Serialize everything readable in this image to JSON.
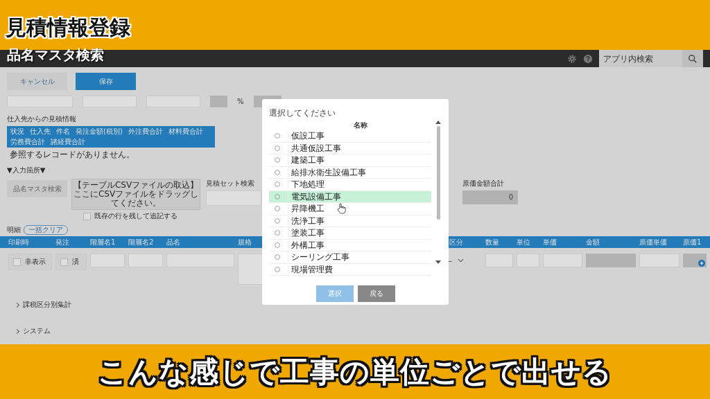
{
  "video_title": "見積情報登録",
  "video_subtitle": "品名マスタ検索",
  "caption": "こんな感じで工事の単位ごとで出せる",
  "app_bar": {
    "search": {
      "placeholder": "アプリ内検索"
    }
  },
  "actions": [
    {
      "label": "キャンセル",
      "kind": "secondary"
    },
    {
      "label": "保存",
      "kind": "primary"
    }
  ],
  "percent_unit": "%",
  "supplier_section": {
    "title": "仕入先からの見積情報",
    "columns": [
      "状況",
      "仕入先",
      "件名",
      "発注金額(税別)",
      "外注費合計",
      "材料費合計",
      "労務費合計",
      "諸経費合計"
    ],
    "empty_message": "参照するレコードがありません。"
  },
  "input_section": {
    "title": "▼入力箇所▼",
    "master_button": {
      "label": "品名マスタ検索",
      "disabled": true
    },
    "csv_drop": {
      "title": "【テーブルCSVファイルの取込】",
      "hint": "ここにCSVファイルをドラッグしてください。"
    },
    "keep_rows": {
      "label": "既存の行を残して追記する",
      "checked": false
    },
    "set_search": {
      "label": "見積セット検索"
    },
    "cost_total": {
      "label": "原価金額合計",
      "value": "0"
    }
  },
  "details": {
    "title": "明細",
    "clear_button": "一括クリア",
    "columns": [
      {
        "label": "印刷時",
        "cell": {
          "kind": "checkbox",
          "label": "非表示",
          "checked": false
        }
      },
      {
        "label": "発注",
        "cell": {
          "kind": "checkbox",
          "label": "済",
          "checked": false
        }
      },
      {
        "label": "階層名1",
        "cell": {
          "kind": "input"
        }
      },
      {
        "label": "階層名2",
        "cell": {
          "kind": "input"
        }
      },
      {
        "label": "品名",
        "cell": {
          "kind": "input"
        }
      },
      {
        "label": "規格",
        "cell": {
          "kind": "tall"
        }
      },
      {
        "label": "区分",
        "cell": {
          "kind": "select",
          "value": "—"
        }
      },
      {
        "label": "数量",
        "cell": {
          "kind": "input"
        }
      },
      {
        "label": "単位",
        "cell": {
          "kind": "input"
        }
      },
      {
        "label": "単価",
        "cell": {
          "kind": "input"
        }
      },
      {
        "label": "金額",
        "cell": {
          "kind": "readonly"
        }
      },
      {
        "label": "原価単価",
        "cell": {
          "kind": "input"
        }
      },
      {
        "label": "原価1",
        "cell": {
          "kind": "readonly"
        }
      }
    ]
  },
  "collapsibles": [
    {
      "label": "課税区分別集計",
      "expanded": false
    },
    {
      "label": "システム",
      "expanded": false
    }
  ],
  "dialog": {
    "prompt": "選択してください",
    "column": "名称",
    "items": [
      {
        "name": "仮設工事",
        "selected": false,
        "highlighted": false
      },
      {
        "name": "共通仮設工事",
        "selected": false,
        "highlighted": false
      },
      {
        "name": "建築工事",
        "selected": false,
        "highlighted": false
      },
      {
        "name": "給排水衛生設備工事",
        "selected": false,
        "highlighted": false
      },
      {
        "name": "下地処理",
        "selected": false,
        "highlighted": false
      },
      {
        "name": "電気設備工事",
        "selected": false,
        "highlighted": true
      },
      {
        "name": "昇降機工",
        "selected": false,
        "highlighted": false
      },
      {
        "name": "洗浄工事",
        "selected": false,
        "highlighted": false
      },
      {
        "name": "塗装工事",
        "selected": false,
        "highlighted": false
      },
      {
        "name": "外構工事",
        "selected": false,
        "highlighted": false
      },
      {
        "name": "シーリング工事",
        "selected": false,
        "highlighted": false
      },
      {
        "name": "現場管理費",
        "selected": false,
        "highlighted": false
      }
    ],
    "buttons": [
      {
        "label": "選択",
        "disabled": true
      },
      {
        "label": "戻る",
        "disabled": false
      }
    ]
  }
}
